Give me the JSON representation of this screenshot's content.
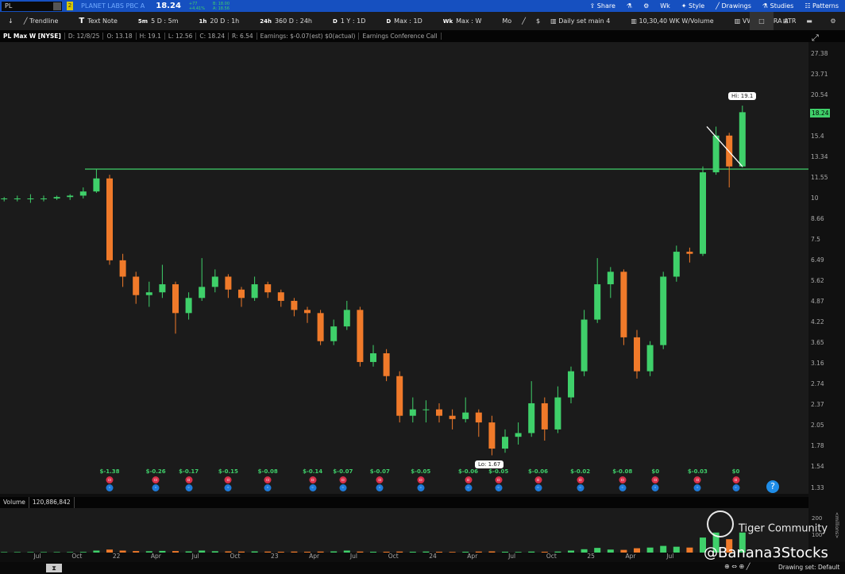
{
  "topbar": {
    "symbol": "PL",
    "link": "2",
    "company": "PLANET LABS PBC A",
    "last": "18.24",
    "change": "+77",
    "change_pct": "+4.41%",
    "bid": "B: 18.00",
    "ask": "A: 18.56",
    "items": [
      "Share",
      "Wk",
      "Style",
      "Drawings",
      "Studies",
      "Patterns"
    ]
  },
  "toolbar": {
    "items": [
      "Trendline",
      "Text Note"
    ],
    "periods": [
      {
        "k": "5m",
        "l": "5 D : 5m"
      },
      {
        "k": "1h",
        "l": "20 D : 1h"
      },
      {
        "k": "24h",
        "l": "360 D : 24h"
      },
      {
        "k": "D",
        "l": "1 Y : 1D"
      },
      {
        "k": "D",
        "l": "Max : 1D"
      },
      {
        "k": "Wk",
        "l": "Max : W"
      }
    ],
    "mo": "Mo",
    "sets": [
      "Daily set main 4",
      "10,30,40 WK W/Volume",
      "VWAP INTRA ATR"
    ]
  },
  "info": {
    "title": "PL Max W [NYSE]",
    "date": "D: 12/8/25",
    "open": "O: 13.18",
    "high": "H: 19.1",
    "low": "L: 12.56",
    "close": "C: 18.24",
    "range": "R: 6.54",
    "earnings": "Earnings: $-0.07(est) $0(actual)",
    "call": "Earnings Conference Call"
  },
  "volume": {
    "label": "Volume",
    "value": "120,886,842",
    "axis": [
      "200",
      "100"
    ],
    "unit": "<millions>"
  },
  "annotations": {
    "hi": "Hi: 19.1",
    "lo": "Lo: 1.67",
    "last_badge": "18.24",
    "help": "?"
  },
  "watermark": {
    "brand": "Tiger Community",
    "handle": "@Banana3Stocks"
  },
  "bottom": {
    "drawing_set": "Drawing set: Default"
  },
  "colors": {
    "up": "#3fd06a",
    "down": "#f07a2a",
    "level": "#3fd06a",
    "trendline": "#ffffff"
  },
  "chart_data": {
    "type": "candlestick",
    "scale": "log",
    "price_ticks": [
      "27.38",
      "23.71",
      "20.54",
      "17.78",
      "15.4",
      "13.34",
      "11.55",
      "10",
      "8.66",
      "7.5",
      "6.49",
      "5.62",
      "4.87",
      "4.22",
      "3.65",
      "3.16",
      "2.74",
      "2.37",
      "2.05",
      "1.78",
      "1.54",
      "1.33"
    ],
    "x_ticks": [
      {
        "m": 0,
        "l": "Jul"
      },
      {
        "m": 3,
        "l": "Oct"
      },
      {
        "m": 6,
        "l": "22"
      },
      {
        "m": 9,
        "l": "Apr"
      },
      {
        "m": 12,
        "l": "Jul"
      },
      {
        "m": 15,
        "l": "Oct"
      },
      {
        "m": 18,
        "l": "23"
      },
      {
        "m": 21,
        "l": "Apr"
      },
      {
        "m": 24,
        "l": "Jul"
      },
      {
        "m": 27,
        "l": "Oct"
      },
      {
        "m": 30,
        "l": "24"
      },
      {
        "m": 33,
        "l": "Apr"
      },
      {
        "m": 36,
        "l": "Jul"
      },
      {
        "m": 39,
        "l": "Oct"
      },
      {
        "m": 42,
        "l": "25"
      },
      {
        "m": 45,
        "l": "Apr"
      },
      {
        "m": 48,
        "l": "Jul"
      }
    ],
    "horizontal_level": 12.27,
    "trendline": [
      {
        "m": 50.3,
        "p": 16.5
      },
      {
        "m": 53,
        "p": 12.5
      }
    ],
    "monthly_ohlc": [
      [
        10,
        10.1,
        9.8,
        10
      ],
      [
        10,
        10.2,
        9.8,
        10
      ],
      [
        10,
        10.3,
        9.7,
        10
      ],
      [
        10,
        10.2,
        9.8,
        10
      ],
      [
        10,
        10.2,
        9.9,
        10.1
      ],
      [
        10.1,
        10.3,
        9.9,
        10.2
      ],
      [
        10.2,
        10.8,
        10,
        10.5
      ],
      [
        10.5,
        12.3,
        10.4,
        11.5
      ],
      [
        11.5,
        11.8,
        6.3,
        6.5
      ],
      [
        6.5,
        6.8,
        5.4,
        5.8
      ],
      [
        5.8,
        6,
        4.8,
        5.1
      ],
      [
        5.1,
        5.6,
        4.7,
        5.2
      ],
      [
        5.2,
        6.3,
        5,
        5.5
      ],
      [
        5.5,
        5.6,
        3.9,
        4.5
      ],
      [
        4.5,
        5.2,
        4.3,
        5
      ],
      [
        5,
        6.6,
        4.9,
        5.4
      ],
      [
        5.4,
        6.1,
        5.2,
        5.8
      ],
      [
        5.8,
        5.9,
        5,
        5.3
      ],
      [
        5.3,
        5.4,
        4.7,
        5
      ],
      [
        5,
        5.8,
        4.9,
        5.5
      ],
      [
        5.5,
        5.6,
        5,
        5.2
      ],
      [
        5.2,
        5.3,
        4.7,
        4.9
      ],
      [
        4.9,
        5,
        4.4,
        4.6
      ],
      [
        4.6,
        4.7,
        4.2,
        4.5
      ],
      [
        4.5,
        4.6,
        3.6,
        3.7
      ],
      [
        3.7,
        4.3,
        3.6,
        4.1
      ],
      [
        4.1,
        4.9,
        4,
        4.6
      ],
      [
        4.6,
        4.7,
        3.1,
        3.2
      ],
      [
        3.2,
        3.6,
        3.1,
        3.4
      ],
      [
        3.4,
        3.5,
        2.8,
        2.9
      ],
      [
        2.9,
        3,
        2.1,
        2.2
      ],
      [
        2.2,
        2.5,
        2.1,
        2.3
      ],
      [
        2.3,
        2.45,
        2.1,
        2.3
      ],
      [
        2.3,
        2.4,
        2.1,
        2.2
      ],
      [
        2.2,
        2.3,
        2,
        2.15
      ],
      [
        2.15,
        2.5,
        2.1,
        2.25
      ],
      [
        2.25,
        2.3,
        1.9,
        2.1
      ],
      [
        2.1,
        2.2,
        1.67,
        1.75
      ],
      [
        1.75,
        2,
        1.7,
        1.9
      ],
      [
        1.9,
        2.1,
        1.8,
        1.95
      ],
      [
        1.95,
        2.8,
        1.9,
        2.4
      ],
      [
        2.4,
        2.5,
        1.85,
        2
      ],
      [
        2,
        2.7,
        1.95,
        2.5
      ],
      [
        2.5,
        3.1,
        2.4,
        3
      ],
      [
        3,
        4.6,
        2.9,
        4.3
      ],
      [
        4.3,
        6.6,
        4.2,
        5.5
      ],
      [
        5.5,
        6.2,
        5,
        6
      ],
      [
        6,
        6.1,
        3.6,
        3.8
      ],
      [
        3.8,
        4,
        2.85,
        3
      ],
      [
        3,
        3.7,
        2.9,
        3.6
      ],
      [
        3.6,
        6,
        3.5,
        5.8
      ],
      [
        5.8,
        7.2,
        5.6,
        6.9
      ],
      [
        6.9,
        7.1,
        6.4,
        6.8
      ],
      [
        6.8,
        12.5,
        6.7,
        12
      ],
      [
        12,
        16.5,
        11.8,
        15.5
      ],
      [
        15.5,
        15.8,
        10.8,
        12.5
      ],
      [
        12.5,
        19.1,
        12.4,
        18.24
      ]
    ],
    "first_month": -3,
    "monthly_volume_millions": [
      3,
      3,
      3,
      3,
      3,
      3,
      4,
      12,
      18,
      12,
      9,
      8,
      10,
      9,
      7,
      12,
      8,
      7,
      6,
      7,
      6,
      5,
      6,
      5,
      6,
      7,
      12,
      6,
      5,
      5,
      6,
      5,
      6,
      5,
      4,
      5,
      6,
      7,
      5,
      4,
      6,
      5,
      6,
      12,
      20,
      28,
      18,
      16,
      26,
      30,
      40,
      35,
      30,
      90,
      120,
      80,
      120
    ],
    "earnings": [
      {
        "m": 5.0,
        "v": "$-1.38"
      },
      {
        "m": 8.5,
        "v": "$-0.26"
      },
      {
        "m": 11,
        "v": "$-0.17"
      },
      {
        "m": 14,
        "v": "$-0.15"
      },
      {
        "m": 17,
        "v": "$-0.08"
      },
      {
        "m": 20.4,
        "v": "$-0.14"
      },
      {
        "m": 22.7,
        "v": "$-0.07"
      },
      {
        "m": 25.5,
        "v": "$-0.07"
      },
      {
        "m": 28.6,
        "v": "$-0.05"
      },
      {
        "m": 32.2,
        "v": "$-0.06"
      },
      {
        "m": 34.5,
        "v": "$-0.05"
      },
      {
        "m": 37.5,
        "v": "$-0.06"
      },
      {
        "m": 40.7,
        "v": "$-0.02"
      },
      {
        "m": 43.9,
        "v": "$-0.08"
      },
      {
        "m": 46.4,
        "v": "$0"
      },
      {
        "m": 49.6,
        "v": "$-0.03"
      },
      {
        "m": 52.5,
        "v": "$0"
      }
    ]
  }
}
